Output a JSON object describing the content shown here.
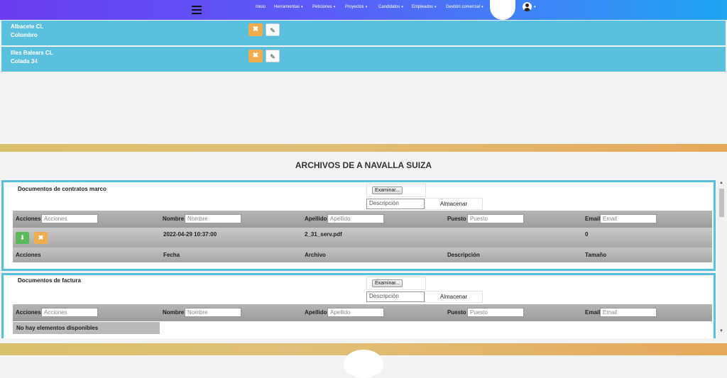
{
  "nav": {
    "items": [
      "Inicio",
      "Herramientas",
      "Peticiones",
      "Proyectos",
      "Candidatos",
      "Empleados",
      "Gestión comercial"
    ],
    "caret": "▾",
    "user_caret": "▾"
  },
  "rows": [
    {
      "line1": "Albacete CL",
      "line2": "Colombro"
    },
    {
      "line1": "Illes Balears CL",
      "line2": "Colada 34"
    }
  ],
  "icons": {
    "delete": "✖",
    "edit": "✎",
    "download": "⬇"
  },
  "section_title": "ARCHIVOS DE A NAVALLA SUIZA",
  "panels": [
    {
      "title": "Documentos de contratos marco",
      "browse": "Examinar...",
      "desc_placeholder": "Descripción",
      "save": "Almacenar",
      "filters": [
        {
          "label": "Acciones",
          "placeholder": "Acciones"
        },
        {
          "label": "Nombre",
          "placeholder": "Nombre"
        },
        {
          "label": "Apellido",
          "placeholder": "Apellido"
        },
        {
          "label": "Puesto",
          "placeholder": "Puesto"
        },
        {
          "label": "Email",
          "placeholder": "Email"
        }
      ],
      "row": {
        "fecha": "2022-04-29 10:37:00",
        "archivo": "2_31_serv.pdf",
        "tamano": "0"
      },
      "footer": [
        "Acciones",
        "Fecha",
        "Archivo",
        "Descripción",
        "Tamaño"
      ]
    },
    {
      "title": "Documentos de factura",
      "browse": "Examinar...",
      "desc_placeholder": "Descripción",
      "save": "Almacenar",
      "filters": [
        {
          "label": "Acciones",
          "placeholder": "Acciones"
        },
        {
          "label": "Nombre",
          "placeholder": "Nombre"
        },
        {
          "label": "Apellido",
          "placeholder": "Apellido"
        },
        {
          "label": "Puesto",
          "placeholder": "Puesto"
        },
        {
          "label": "Email",
          "placeholder": "Email"
        }
      ],
      "empty": "No hay elementos disponibles"
    }
  ],
  "scroll": {
    "up": "▲",
    "down": "▼"
  }
}
